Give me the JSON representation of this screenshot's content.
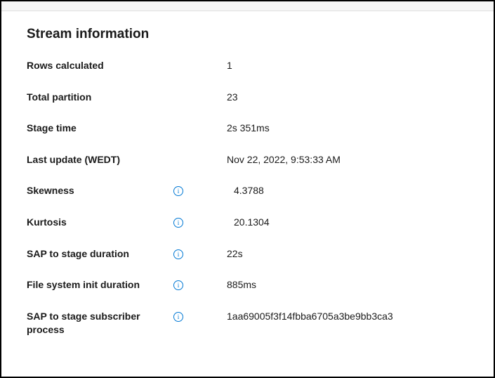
{
  "section": {
    "title": "Stream information"
  },
  "rows": {
    "rows_calculated": {
      "label": "Rows calculated",
      "value": "1"
    },
    "total_partition": {
      "label": "Total partition",
      "value": "23"
    },
    "stage_time": {
      "label": "Stage time",
      "value": "2s 351ms"
    },
    "last_update": {
      "label": "Last update (WEDT)",
      "value": "Nov 22, 2022, 9:53:33 AM"
    },
    "skewness": {
      "label": "Skewness",
      "value": "4.3788"
    },
    "kurtosis": {
      "label": "Kurtosis",
      "value": "20.1304"
    },
    "sap_stage_duration": {
      "label": "SAP to stage duration",
      "value": "22s"
    },
    "fs_init_duration": {
      "label": "File system init duration",
      "value": "885ms"
    },
    "sap_subscriber": {
      "label": "SAP to stage subscriber process",
      "value": "1aa69005f3f14fbba6705a3be9bb3ca3"
    }
  }
}
